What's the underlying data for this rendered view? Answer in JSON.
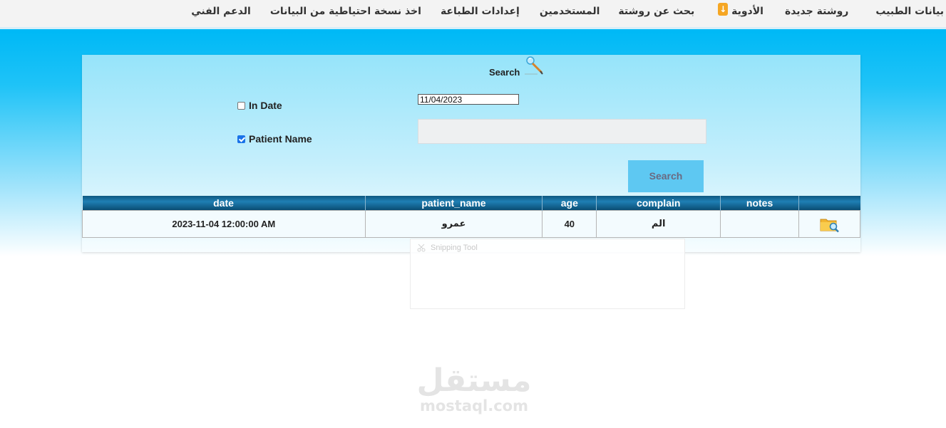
{
  "nav": {
    "items": [
      {
        "label": "بيانات الطبيب"
      },
      {
        "label": "روشتة جديدة"
      },
      {
        "label": "الأدوية",
        "badge": "↓"
      },
      {
        "label": "بحث عن روشتة"
      },
      {
        "label": "المستخدمين"
      },
      {
        "label": "إعدادات الطباعة"
      },
      {
        "label": "اخذ نسخة احتياطية من البيانات"
      },
      {
        "label": "الدعم الفني"
      }
    ]
  },
  "search": {
    "title": "Search",
    "in_date_label": "In Date",
    "in_date_checked": false,
    "patient_name_label": "Patient Name",
    "patient_name_checked": true,
    "date_value": "11/04/2023",
    "patient_name_value": "",
    "button_label": "Search"
  },
  "table": {
    "columns": [
      "date",
      "patient_name",
      "age",
      "complain",
      "notes",
      ""
    ],
    "rows": [
      {
        "date": "2023-11-04 12:00:00 AM",
        "patient_name": "عمرو",
        "age": "40",
        "complain": "الم",
        "notes": ""
      }
    ]
  },
  "overlay": {
    "title": "Snipping Tool"
  },
  "watermark": {
    "arabic": "مستقل",
    "latin": "mostaql.com"
  },
  "colors": {
    "accent": "#00b9f6",
    "table_header": "#0e5880",
    "button": "#5ec8f2",
    "badge": "#f5a623"
  }
}
